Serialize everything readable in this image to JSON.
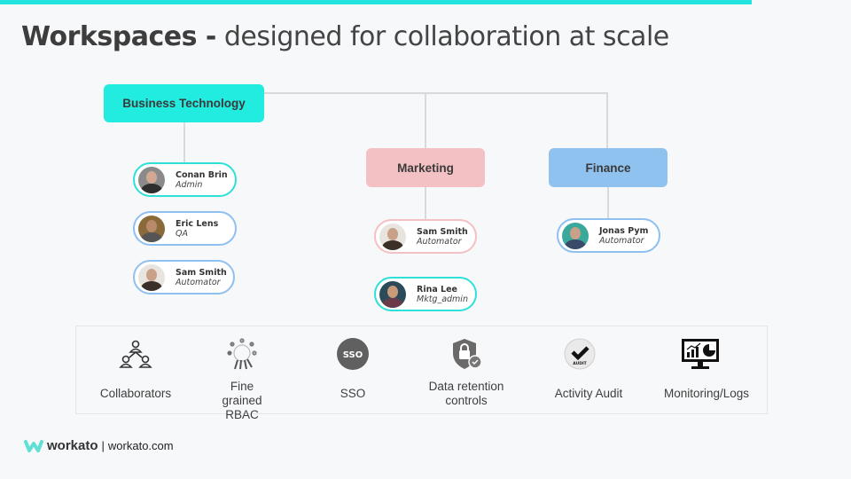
{
  "slide": {
    "title_bold": "Workspaces -",
    "title_rest": "designed for collaboration at scale",
    "accent_color": "#22e3dd"
  },
  "org": {
    "departments": [
      {
        "name": "Business Technology",
        "color": "#22ebe0"
      },
      {
        "name": "Marketing",
        "color": "#f3c1c3"
      },
      {
        "name": "Finance",
        "color": "#90c2f0"
      }
    ],
    "members": {
      "business_technology": [
        {
          "name": "Conan Brin",
          "role": "Admin",
          "border": "#2ee0d8"
        },
        {
          "name": "Eric Lens",
          "role": "QA",
          "border": "#8fc0ef"
        },
        {
          "name": "Sam Smith",
          "role": "Automator",
          "border": "#8fc0ef"
        }
      ],
      "marketing": [
        {
          "name": "Sam Smith",
          "role": "Automator",
          "border": "#f3c1c3"
        },
        {
          "name": "Rina Lee",
          "role": "Mktg_admin",
          "border": "#2ee0d8"
        }
      ],
      "finance": [
        {
          "name": "Jonas Pym",
          "role": "Automator",
          "border": "#8fc0ef"
        }
      ]
    }
  },
  "features": [
    {
      "label": "Collaborators",
      "icon": "collaborators-icon"
    },
    {
      "label": "Fine grained RBAC",
      "icon": "rbac-keys-icon"
    },
    {
      "label": "SSO",
      "icon": "sso-icon"
    },
    {
      "label": "Data retention controls",
      "icon": "shield-lock-icon"
    },
    {
      "label": "Activity Audit",
      "icon": "audit-check-icon"
    },
    {
      "label": "Monitoring/Logs",
      "icon": "monitor-chart-icon"
    }
  ],
  "footer": {
    "brand": "workato",
    "separator": "|",
    "url": "workato.com"
  }
}
